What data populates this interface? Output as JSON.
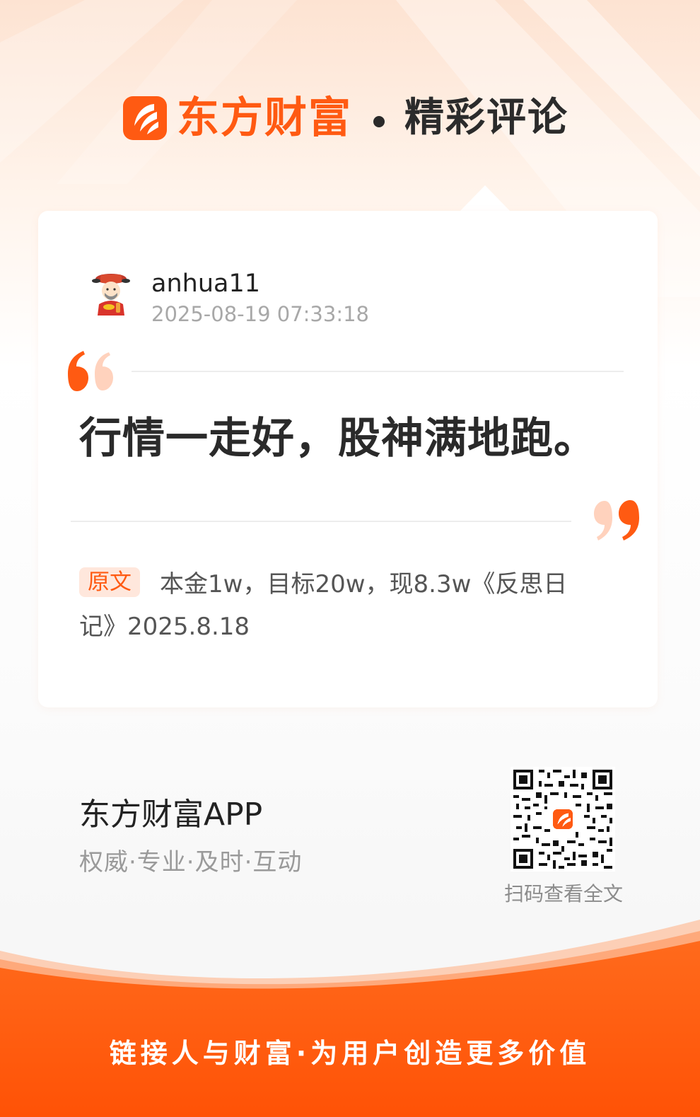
{
  "brand": {
    "name": "东方财富",
    "section_title": "精彩评论",
    "primary_color": "#ff5a12"
  },
  "comment": {
    "username": "anhua11",
    "timestamp": "2025-08-19 07:33:18",
    "avatar_icon": "god-of-wealth-avatar",
    "text": "行情一走好，股神满地跑。",
    "original_label": "原文",
    "original_text": "本金1w，目标20w，现8.3w《反思日记》2025.8.18"
  },
  "footer": {
    "app_name": "东方财富APP",
    "slogan": "权威·专业·及时·互动",
    "qr_caption": "扫码查看全文",
    "tagline": "链接人与财富·为用户创造更多价值"
  }
}
